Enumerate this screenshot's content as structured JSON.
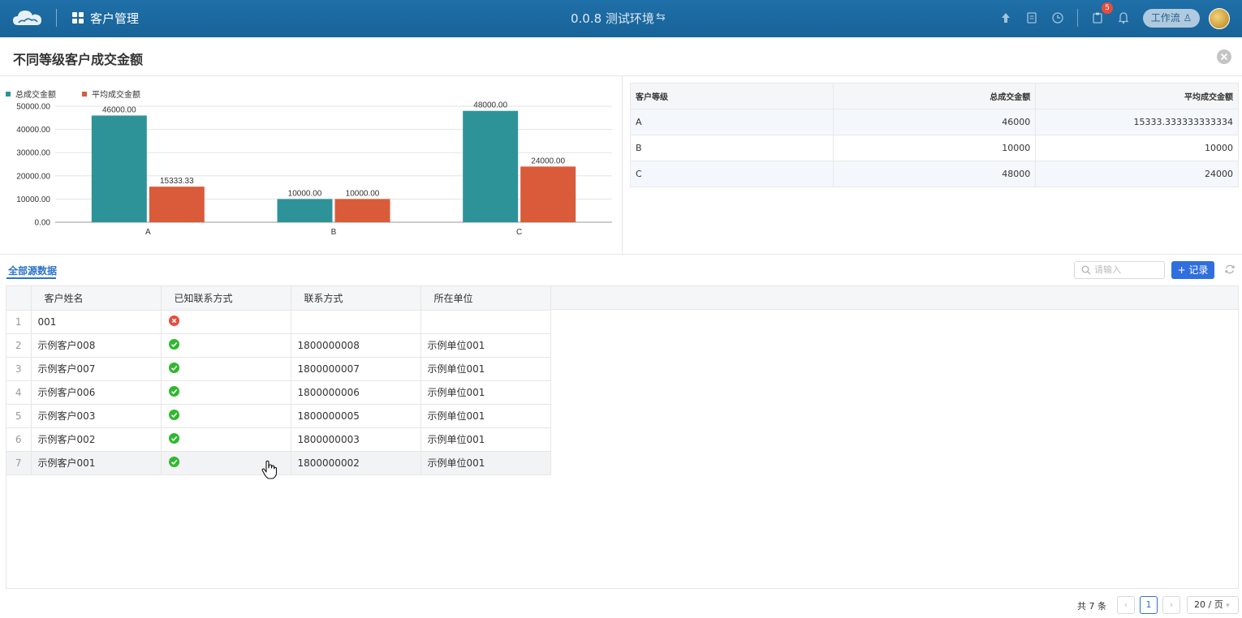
{
  "topbar": {
    "app_name": "客户管理",
    "env_title": "0.0.8 测试环境",
    "env_switch_icon": "swap-icon",
    "notification_count": "5",
    "workflow_label": "工作流 ♙"
  },
  "page": {
    "title": "不同等级客户成交金额"
  },
  "chart_data": {
    "type": "bar",
    "categories": [
      "A",
      "B",
      "C"
    ],
    "series": [
      {
        "name": "总成交金额",
        "values": [
          46000,
          10000,
          48000
        ],
        "color": "#2e9399",
        "labels": [
          "46000.00",
          "10000.00",
          "48000.00"
        ]
      },
      {
        "name": "平均成交金额",
        "values": [
          15333.33,
          10000,
          24000
        ],
        "color": "#d95b3a",
        "labels": [
          "15333.33",
          "10000.00",
          "24000.00"
        ]
      }
    ],
    "yticks": [
      "0.00",
      "10000.00",
      "20000.00",
      "30000.00",
      "40000.00",
      "50000.00"
    ],
    "ylim": [
      0,
      50000
    ],
    "grid": true,
    "legend": "top-left"
  },
  "summary_table": {
    "headers": [
      "客户等级",
      "总成交金额",
      "平均成交金额"
    ],
    "rows": [
      [
        "A",
        "46000",
        "15333.333333333334"
      ],
      [
        "B",
        "10000",
        "10000"
      ],
      [
        "C",
        "48000",
        "24000"
      ]
    ]
  },
  "data_section": {
    "tab_label": "全部源数据",
    "search_placeholder": "请输入",
    "add_label": "+ 记录",
    "columns": [
      "客户姓名",
      "已知联系方式",
      "联系方式",
      "所在单位"
    ],
    "rows": [
      {
        "idx": "1",
        "name": "001",
        "known": false,
        "phone": "",
        "unit": ""
      },
      {
        "idx": "2",
        "name": "示例客户008",
        "known": true,
        "phone": "1800000008",
        "unit": "示例单位001"
      },
      {
        "idx": "3",
        "name": "示例客户007",
        "known": true,
        "phone": "1800000007",
        "unit": "示例单位001"
      },
      {
        "idx": "4",
        "name": "示例客户006",
        "known": true,
        "phone": "1800000006",
        "unit": "示例单位001"
      },
      {
        "idx": "5",
        "name": "示例客户003",
        "known": true,
        "phone": "1800000005",
        "unit": "示例单位001"
      },
      {
        "idx": "6",
        "name": "示例客户002",
        "known": true,
        "phone": "1800000003",
        "unit": "示例单位001"
      },
      {
        "idx": "7",
        "name": "示例客户001",
        "known": true,
        "phone": "1800000002",
        "unit": "示例单位001"
      }
    ]
  },
  "pagination": {
    "total": "共 7 条",
    "current_page": "1",
    "page_size": "20 / 页"
  },
  "colors": {
    "topbar": "#1f6fa8",
    "accent": "#2f6fde",
    "known_true": "#2eb82e",
    "known_false": "#e84c3d"
  }
}
